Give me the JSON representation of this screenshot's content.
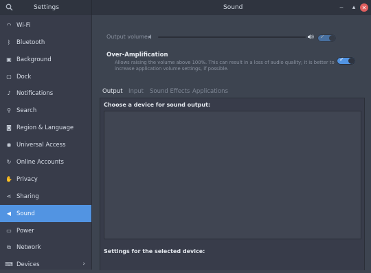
{
  "titlebar": {
    "left_title": "Settings",
    "center_title": "Sound",
    "minimize": "‒",
    "maximize": "▴",
    "close": "✕"
  },
  "sidebar": {
    "items": [
      {
        "label": "Wi-Fi",
        "icon": "wifi-icon",
        "glyph": "◠"
      },
      {
        "label": "Bluetooth",
        "icon": "bluetooth-icon",
        "glyph": "ᛒ"
      },
      {
        "label": "Background",
        "icon": "background-icon",
        "glyph": "▣"
      },
      {
        "label": "Dock",
        "icon": "dock-icon",
        "glyph": "▢"
      },
      {
        "label": "Notifications",
        "icon": "bell-icon",
        "glyph": "♪"
      },
      {
        "label": "Search",
        "icon": "search-icon",
        "glyph": "⚲"
      },
      {
        "label": "Region & Language",
        "icon": "camera-icon",
        "glyph": "◙"
      },
      {
        "label": "Universal Access",
        "icon": "universal-access-icon",
        "glyph": "◉"
      },
      {
        "label": "Online Accounts",
        "icon": "online-accounts-icon",
        "glyph": "↻"
      },
      {
        "label": "Privacy",
        "icon": "privacy-icon",
        "glyph": "✋"
      },
      {
        "label": "Sharing",
        "icon": "sharing-icon",
        "glyph": "⋖"
      },
      {
        "label": "Sound",
        "icon": "speaker-icon",
        "glyph": "◀"
      },
      {
        "label": "Power",
        "icon": "power-icon",
        "glyph": "▭"
      },
      {
        "label": "Network",
        "icon": "network-icon",
        "glyph": "⧉"
      },
      {
        "label": "Devices",
        "icon": "devices-icon",
        "glyph": "⌨"
      }
    ],
    "active_index": 11,
    "devices_arrow": "›"
  },
  "main": {
    "output_volume_label": "Output volume:",
    "volume_low_glyph": "🔈",
    "volume_high_glyph": "🔊",
    "over_amplification_title": "Over-Amplification",
    "over_amplification_desc": "Allows raising the volume above 100%. This can result in a loss of audio quality; it is better to increase application volume settings, if possible.",
    "tabs": [
      "Output",
      "Input",
      "Sound Effects",
      "Applications"
    ],
    "active_tab": "Output",
    "device_header": "Choose a device for sound output:",
    "settings_label": "Settings for the selected device:",
    "toggle_check": "✓"
  },
  "colors": {
    "accent": "#5294e2",
    "sidebar_bg": "#383c4a",
    "main_bg": "#3d4450",
    "titlebar_bg": "#2f343f"
  }
}
